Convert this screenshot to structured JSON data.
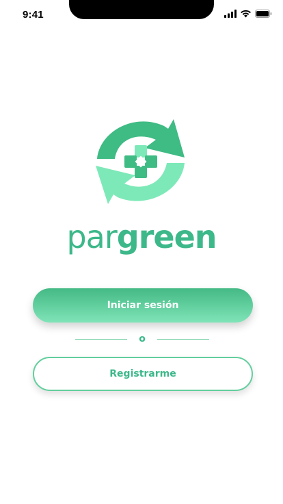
{
  "status_bar": {
    "time": "9:41",
    "icons": [
      "signal-icon",
      "wifi-icon",
      "battery-icon"
    ]
  },
  "brand": {
    "logo": "pargreen-logo-icon",
    "name_part1": "par",
    "name_part2": "green",
    "colors": {
      "dark_green": "#3db88a",
      "light_green": "#7fe8b9",
      "primary_gradient_top": "#44b985",
      "primary_gradient_bottom": "#7fe4b7"
    }
  },
  "auth": {
    "login_label": "Iniciar sesión",
    "divider_label": "o",
    "register_label": "Registrarme"
  }
}
